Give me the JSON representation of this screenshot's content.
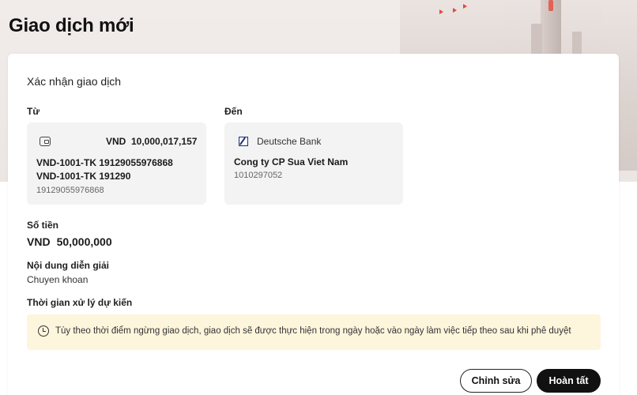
{
  "page": {
    "title": "Giao dịch mới"
  },
  "confirm": {
    "section_title": "Xác nhận giao dịch",
    "from": {
      "label": "Từ",
      "icon": "wallet-icon",
      "currency": "VND",
      "balance": "10,000,017,157",
      "account_name_line1": "VND-1001-TK 19129055976868",
      "account_name_line2": "VND-1001-TK 191290",
      "account_number": "19129055976868"
    },
    "to": {
      "label": "Đến",
      "bank_logo": "deutsche-bank-logo",
      "bank_name": "Deutsche Bank",
      "beneficiary_name": "Cong ty CP Sua Viet Nam",
      "account_number": "1010297052"
    },
    "amount": {
      "label": "Số tiền",
      "currency": "VND",
      "value": "50,000,000"
    },
    "description": {
      "label": "Nội dung diễn giải",
      "value": "Chuyen khoan"
    },
    "processing": {
      "label": "Thời gian xử lý dự kiến",
      "icon": "clock-icon",
      "notice": "Tùy theo thời điểm ngừng giao dịch, giao dịch sẽ được thực hiện trong ngày hoặc vào ngày làm việc tiếp theo sau khi phê duyệt"
    }
  },
  "actions": {
    "edit_label": "Chỉnh sửa",
    "done_label": "Hoàn tất"
  },
  "colors": {
    "notice_bg": "#fdf5dc",
    "primary_button": "#111111",
    "account_box_bg": "#f3f3f3"
  }
}
